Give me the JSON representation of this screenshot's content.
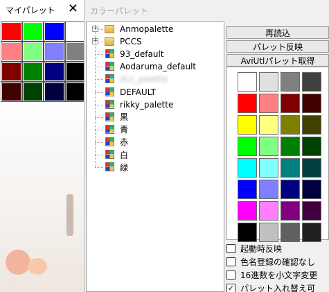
{
  "my_palette": {
    "title": "マイパレット",
    "close_glyph": "✕",
    "swatches": [
      "#ff0000",
      "#00ff00",
      "#0000ff",
      "#ffffff",
      "#ff8080",
      "#80ff80",
      "#8080ff",
      "#808080",
      "#800000",
      "#008000",
      "#000080",
      "#000000",
      "#400000",
      "#004000",
      "#000040",
      "#000000"
    ]
  },
  "color_palette": {
    "title": "カラーパレット",
    "tree": [
      {
        "label": "Anmopalette",
        "type": "folder"
      },
      {
        "label": "PCCS",
        "type": "folder"
      },
      {
        "label": "93_default",
        "type": "palette"
      },
      {
        "label": "Aodaruma_default",
        "type": "palette"
      },
      {
        "label": "dcc_palette",
        "type": "palette",
        "blurred": true
      },
      {
        "label": "DEFAULT",
        "type": "palette"
      },
      {
        "label": "rikky_palette",
        "type": "palette"
      },
      {
        "label": "黒",
        "type": "palette"
      },
      {
        "label": "青",
        "type": "palette"
      },
      {
        "label": "赤",
        "type": "palette"
      },
      {
        "label": "白",
        "type": "palette"
      },
      {
        "label": "緑",
        "type": "palette"
      }
    ],
    "buttons": {
      "reload": "再読込",
      "reflect": "パレット反映",
      "aviutl": "AviUtlパレット取得"
    },
    "swatches": [
      "#ffffff",
      "#e0e0e0",
      "#808080",
      "#404040",
      "#ff0000",
      "#ff8080",
      "#800000",
      "#400000",
      "#ffff00",
      "#ffff80",
      "#808000",
      "#404000",
      "#00ff00",
      "#80ff80",
      "#008000",
      "#004000",
      "#00ffff",
      "#80ffff",
      "#008080",
      "#004040",
      "#0000ff",
      "#8080ff",
      "#000080",
      "#000040",
      "#ff00ff",
      "#ff80ff",
      "#800080",
      "#400040",
      "#000000",
      "#c0c0c0",
      "#606060",
      "#202020"
    ],
    "options": [
      {
        "label": "起動時反映",
        "checked": false
      },
      {
        "label": "色名登録の確認なし",
        "checked": false
      },
      {
        "label": "16進数を小文字変更",
        "checked": false
      },
      {
        "label": "パレット入れ替え可",
        "checked": true
      }
    ]
  }
}
